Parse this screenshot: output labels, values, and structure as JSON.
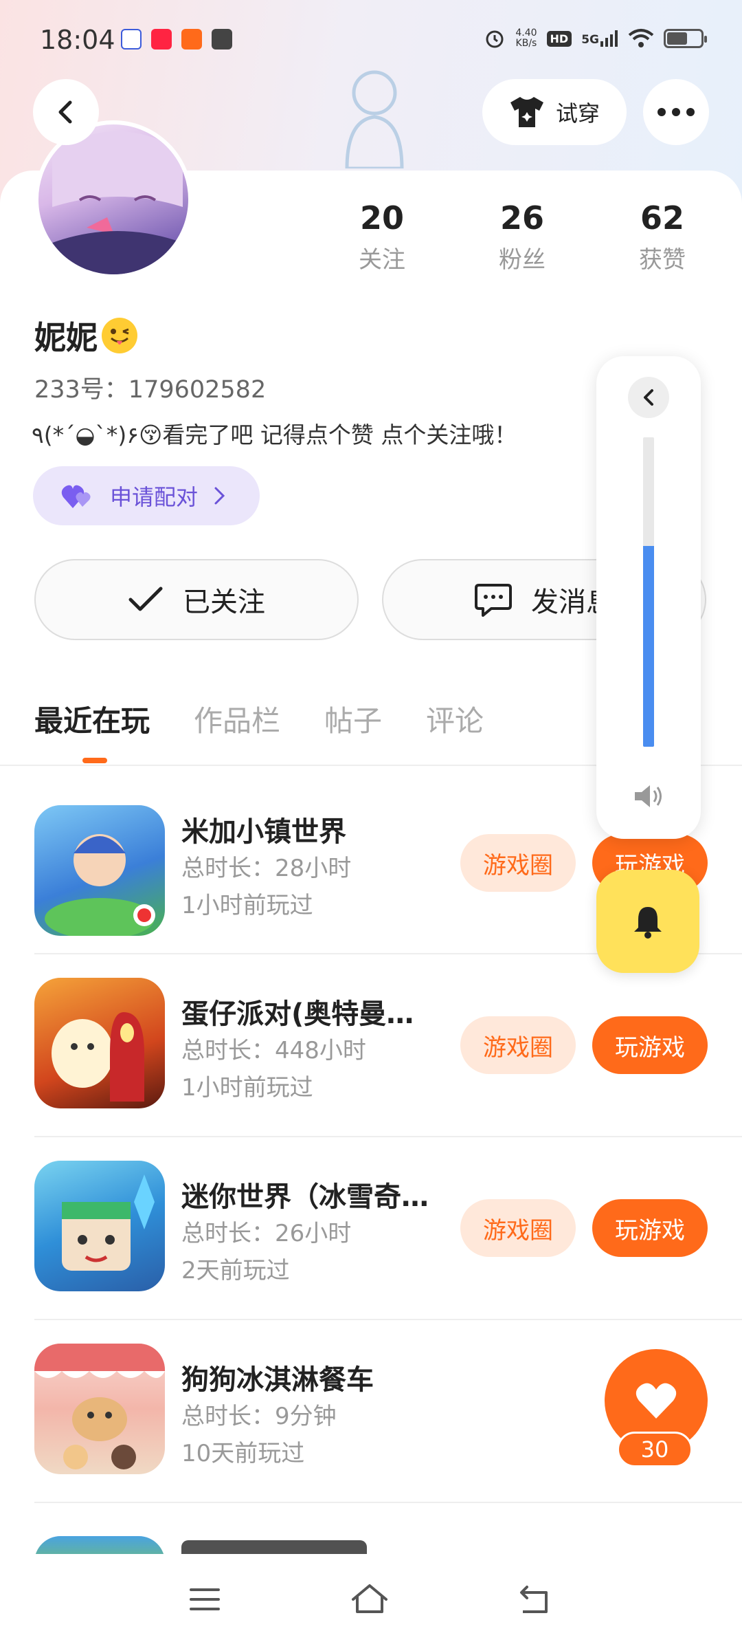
{
  "status_bar": {
    "time": "18:04",
    "net_speed_value": "4.40",
    "net_speed_unit": "KB/s",
    "hd_label": "HD",
    "network_label": "5G"
  },
  "header": {
    "try_on_label": "试穿"
  },
  "profile": {
    "username": "妮妮",
    "user_id": "233号：179602582",
    "bio": "٩(*´◒`*)۶😚看完了吧 记得点个赞 点个关注哦！",
    "stats": [
      {
        "value": "20",
        "label": "关注"
      },
      {
        "value": "26",
        "label": "粉丝"
      },
      {
        "value": "62",
        "label": "获赞"
      }
    ],
    "pair_label": "申请配对",
    "follow_label": "已关注",
    "message_label": "发消息"
  },
  "tabs": [
    {
      "label": "最近在玩",
      "active": true
    },
    {
      "label": "作品栏",
      "active": false
    },
    {
      "label": "帖子",
      "active": false
    },
    {
      "label": "评论",
      "active": false
    }
  ],
  "games": [
    {
      "title": "米加小镇世界",
      "duration": "总时长：28小时",
      "last_played": "1小时前玩过",
      "circle_label": "游戏圈",
      "play_label": "玩游戏"
    },
    {
      "title": "蛋仔派对(奥特曼…",
      "duration": "总时长：448小时",
      "last_played": "1小时前玩过",
      "circle_label": "游戏圈",
      "play_label": "玩游戏"
    },
    {
      "title": "迷你世界（冰雪奇…",
      "duration": "总时长：26小时",
      "last_played": "2天前玩过",
      "circle_label": "游戏圈",
      "play_label": "玩游戏"
    },
    {
      "title": "狗狗冰淇淋餐车",
      "duration": "总时长：9分钟",
      "last_played": "10天前玩过",
      "circle_label": "",
      "play_label": ""
    }
  ],
  "volume": {
    "level": 0.65
  },
  "like": {
    "count": "30"
  },
  "colors": {
    "accent": "#ff6a1a",
    "accent_light": "#ffe8da",
    "pair_purple": "#6a52d8",
    "volume_blue": "#4a8df0",
    "bell_yellow": "#ffe15a"
  }
}
